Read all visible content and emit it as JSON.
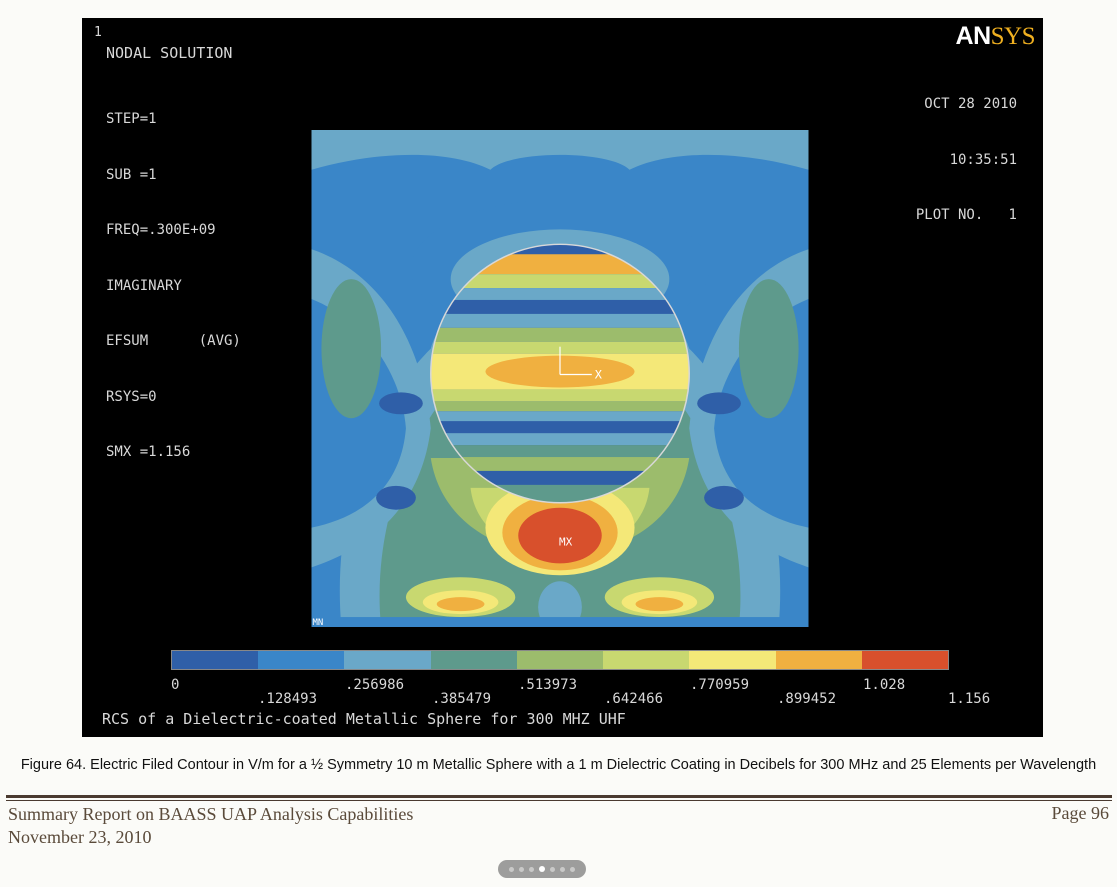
{
  "plot": {
    "window_number": "1",
    "title": "NODAL SOLUTION",
    "info_lines": [
      "STEP=1",
      "SUB =1",
      "FREQ=.300E+09",
      "IMAGINARY",
      "EFSUM      (AVG)",
      "RSYS=0",
      "SMX =1.156"
    ],
    "logo_part1": "AN",
    "logo_part2": "SYS",
    "date": "OCT 28 2010",
    "time": "10:35:51",
    "plot_number": "PLOT NO.   1",
    "marker_max": "MX",
    "marker_min": "MN",
    "axis_label": "X",
    "caption": "RCS of a Dielectric-coated Metallic Sphere for 300 MHZ UHF"
  },
  "colorbar": {
    "colors": [
      "#2f5fa8",
      "#3a86c8",
      "#6aa8c8",
      "#5e9a8c",
      "#9cbc6c",
      "#c8d870",
      "#f4e878",
      "#f0b040",
      "#d8502c"
    ],
    "labels": [
      "0",
      ".128493",
      ".256986",
      ".385479",
      ".513973",
      ".642466",
      ".770959",
      ".899452",
      "1.028",
      "1.156"
    ]
  },
  "document": {
    "figure_caption": "Figure 64.  Electric Filed Contour in V/m for a ½ Symmetry 10 m Metallic Sphere with a 1 m Dielectric Coating in Decibels for 300 MHz and 25 Elements per Wavelength",
    "footer_title": "Summary Report on BAASS UAP Analysis Capabilities",
    "footer_date": "November 23, 2010",
    "page_label": "Page 96"
  },
  "viewer": {
    "page_dots": 7,
    "active_dot": 4
  }
}
